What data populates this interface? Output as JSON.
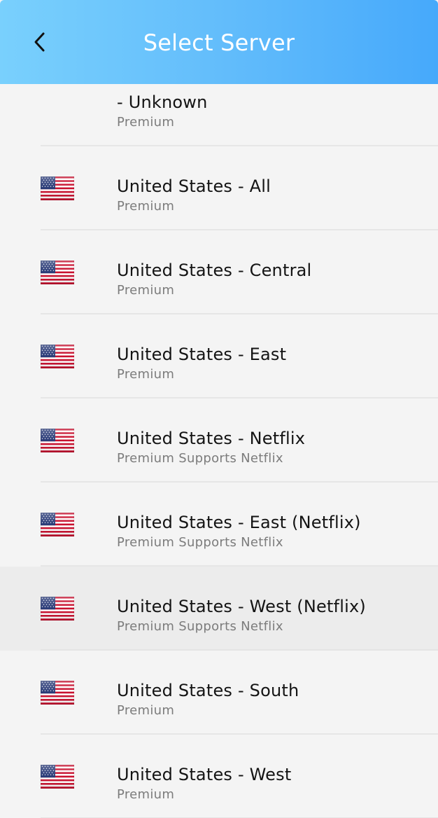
{
  "header": {
    "title": "Select Server",
    "back_icon": "chevron-left-icon",
    "gradient_colors": [
      "#79d0fd",
      "#46a9fb"
    ]
  },
  "servers": [
    {
      "name": " - Unknown",
      "subtitle": "Premium",
      "flag": ""
    },
    {
      "name": "United States - All",
      "subtitle": "Premium",
      "flag": "us-flag-icon"
    },
    {
      "name": "United States - Central",
      "subtitle": "Premium",
      "flag": "us-flag-icon"
    },
    {
      "name": "United States - East",
      "subtitle": "Premium",
      "flag": "us-flag-icon"
    },
    {
      "name": "United States - Netflix",
      "subtitle": "Premium Supports Netflix",
      "flag": "us-flag-icon"
    },
    {
      "name": "United States - East (Netflix)",
      "subtitle": "Premium Supports Netflix",
      "flag": "us-flag-icon"
    },
    {
      "name": "United States - West (Netflix)",
      "subtitle": "Premium Supports Netflix",
      "flag": "us-flag-icon",
      "highlighted": true
    },
    {
      "name": "United States - South",
      "subtitle": "Premium",
      "flag": "us-flag-icon"
    },
    {
      "name": "United States - West",
      "subtitle": "Premium",
      "flag": "us-flag-icon"
    }
  ]
}
